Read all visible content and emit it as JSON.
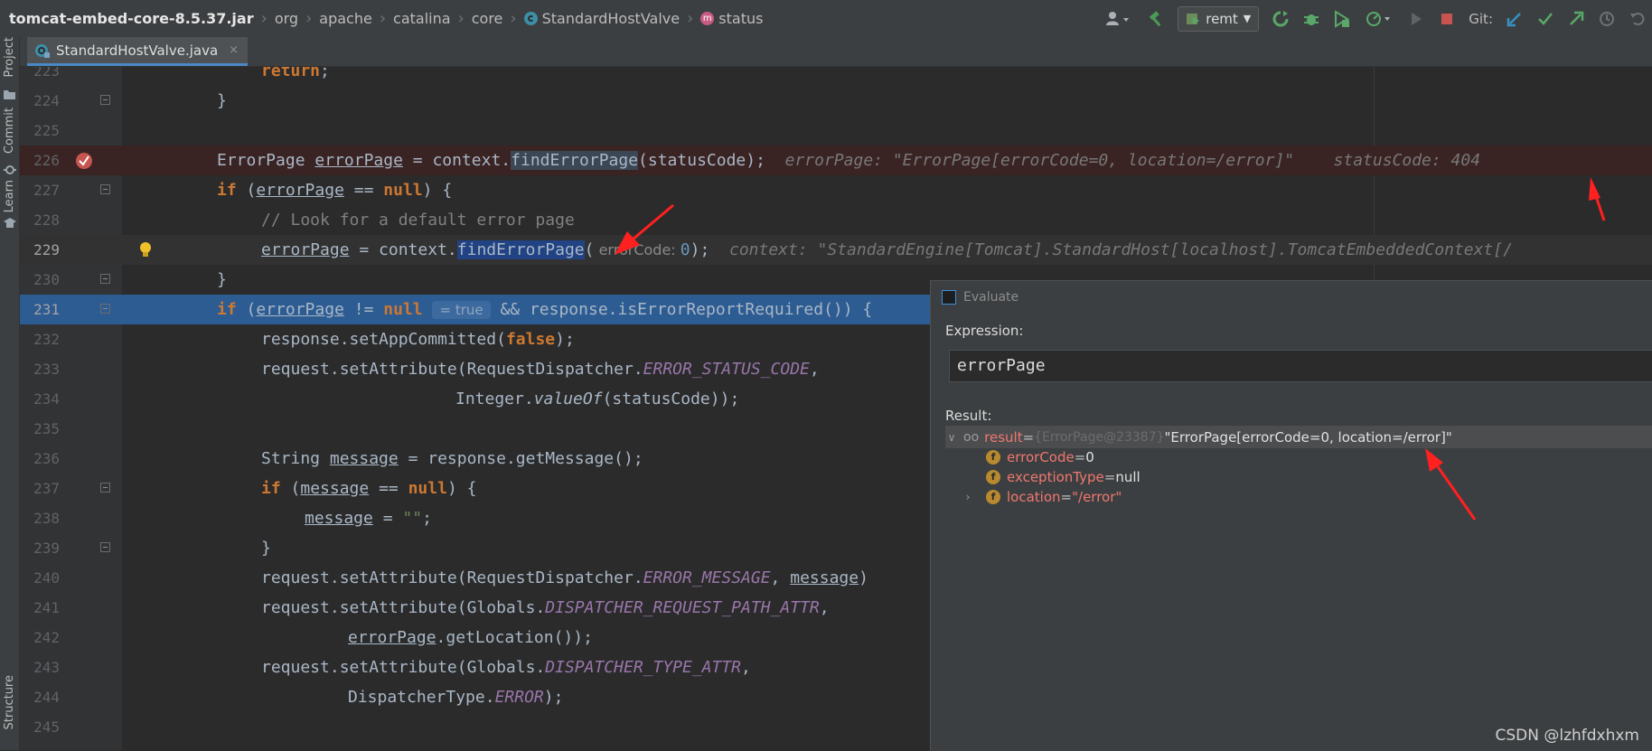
{
  "navbar": {
    "crumbs": [
      "tomcat-embed-core-8.5.37.jar",
      "org",
      "apache",
      "catalina",
      "core",
      "StandardHostValve",
      "status"
    ],
    "run_config": "remt",
    "git_label": "Git:"
  },
  "left_strip": {
    "project": "Project",
    "commit": "Commit",
    "learn": "Learn",
    "structure": "Structure"
  },
  "tab": {
    "title": "StandardHostValve.java",
    "close": "×"
  },
  "editor": {
    "line_numbers": [
      "223",
      "224",
      "225",
      "226",
      "227",
      "228",
      "229",
      "230",
      "231",
      "232",
      "233",
      "234",
      "235",
      "236",
      "237",
      "238",
      "239",
      "240",
      "241",
      "242",
      "243",
      "244",
      "245"
    ],
    "l223": {
      "kw": "return",
      "rest": ";"
    },
    "l224": {
      "brace": "}"
    },
    "l226": {
      "type": "ErrorPage",
      "var": "errorPage",
      "eq": " = context.",
      "method": "findErrorPage",
      "args": "(statusCode);",
      "inlay1": "errorPage: \"ErrorPage[errorCode=0, location=/error]\"",
      "inlay2": "statusCode: 404"
    },
    "l227": {
      "kw": "if",
      "open": " (",
      "var": "errorPage",
      "op": " == ",
      "nul": "null",
      "close": ") {"
    },
    "l228": {
      "comment": "// Look for a default error page"
    },
    "l229": {
      "var": "errorPage",
      "mid": " = context.",
      "method": "findErrorPage",
      "paren": "(",
      "hint": " errorCode: ",
      "num": "0",
      "end": ");",
      "inlay": "context: \"StandardEngine[Tomcat].StandardHost[localhost].TomcatEmbeddedContext[/"
    },
    "l230": {
      "brace": "}"
    },
    "l231": {
      "kw": "if",
      "open": " (",
      "var": "errorPage",
      "op": " != ",
      "nul": "null",
      "inlay_true": "= true",
      "rest": " && response.isErrorReportRequired()) {"
    },
    "l232": {
      "pre": "response.setAppCommitted(",
      "kw": "false",
      "post": ");"
    },
    "l233": {
      "pre": "request.setAttribute(",
      "cls": "RequestDispatcher",
      "dot": ".",
      "const": "ERROR_STATUS_CODE",
      "post": ","
    },
    "l234": {
      "cls": "Integer",
      "dot": ".",
      "method": "valueOf",
      "post": "(statusCode));"
    },
    "l236": {
      "cls": "String",
      "sp": " ",
      "var": "message",
      "post": " = response.getMessage();"
    },
    "l237": {
      "kw": "if",
      "open": " (",
      "var": "message",
      "op": " == ",
      "nul": "null",
      "close": ") {"
    },
    "l238": {
      "var": "message",
      "mid": " = ",
      "str": "\"\"",
      "post": ";"
    },
    "l239": {
      "brace": "}"
    },
    "l240": {
      "pre": "request.setAttribute(",
      "cls": "RequestDispatcher",
      "dot": ".",
      "const": "ERROR_MESSAGE",
      "sep": ", ",
      "var": "message",
      "post": ")"
    },
    "l241": {
      "pre": "request.setAttribute(",
      "cls": "Globals",
      "dot": ".",
      "const": "DISPATCHER_REQUEST_PATH_ATTR",
      "post": ","
    },
    "l242": {
      "var": "errorPage",
      "post": ".getLocation());"
    },
    "l243": {
      "pre": "request.setAttribute(",
      "cls": "Globals",
      "dot": ".",
      "const": "DISPATCHER_TYPE_ATTR",
      "post": ","
    },
    "l244": {
      "cls": "DispatcherType",
      "dot": ".",
      "const": "ERROR",
      "post": ");"
    }
  },
  "evaluate": {
    "title": "Evaluate",
    "expression_label": "Expression:",
    "expression": "errorPage",
    "result_label": "Result:",
    "result": {
      "name": "result",
      "eq": " = ",
      "type": "{ErrorPage@23387}",
      "value": " \"ErrorPage[errorCode=0, location=/error]\"",
      "fields": [
        {
          "name": "errorCode",
          "eq": " = ",
          "value": "0"
        },
        {
          "name": "exceptionType",
          "eq": " = ",
          "value": "null"
        },
        {
          "name": "location",
          "eq": " = ",
          "value": "\"/error\""
        }
      ]
    }
  },
  "watermark": "CSDN @lzhfdxhxm",
  "colors": {
    "keyword": "#cc7832",
    "constant": "#9876aa",
    "comment": "#808080",
    "exec_line": "#2d5c93",
    "breakpoint_line": "#3a2323",
    "arrow": "#ff2020"
  }
}
